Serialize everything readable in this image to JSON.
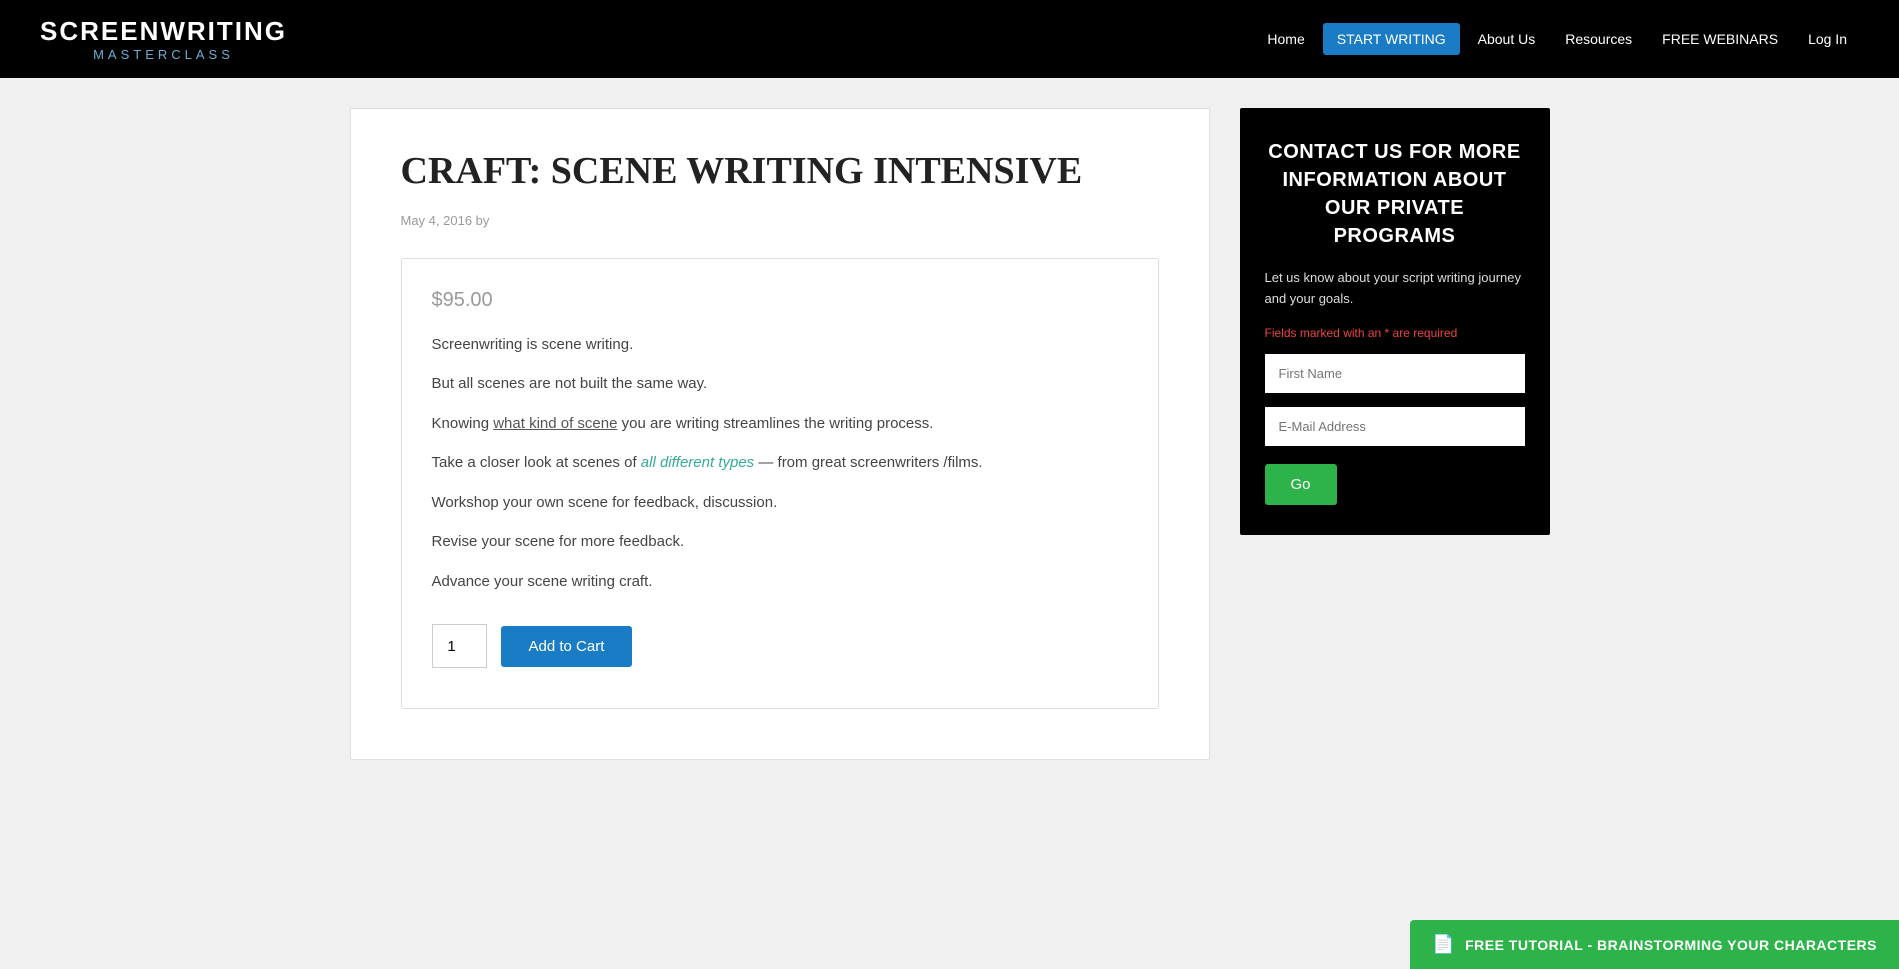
{
  "header": {
    "logo_main": "SCREENWRITING",
    "logo_sub": "MASTERCLASS",
    "nav": [
      {
        "label": "Home",
        "active": false
      },
      {
        "label": "START WRITING",
        "active": true
      },
      {
        "label": "About Us",
        "active": false
      },
      {
        "label": "Resources",
        "active": false
      },
      {
        "label": "FREE WEBINARS",
        "active": false
      },
      {
        "label": "Log In",
        "active": false
      }
    ]
  },
  "article": {
    "title": "CRAFT: SCENE WRITING INTENSIVE",
    "meta": "May 4, 2016 by",
    "product": {
      "price": "$95.00",
      "desc1": "Screenwriting is scene writing.",
      "desc2": "But all scenes are not built the same way.",
      "desc3_before": "Knowing ",
      "desc3_link": "what kind of scene",
      "desc3_after": " you are writing streamlines the writing process.",
      "desc4_before": "Take a closer look at scenes of ",
      "desc4_highlight": "all different types",
      "desc4_after": " — from great screenwriters /films.",
      "desc5": "Workshop your own scene for feedback, discussion.",
      "desc6": "Revise your scene for more feedback.",
      "desc7": "Advance your scene writing craft.",
      "qty_value": "1",
      "add_to_cart": "Add to Cart"
    }
  },
  "sidebar": {
    "contact_title": "CONTACT US FOR MORE INFORMATION ABOUT OUR PRIVATE PROGRAMS",
    "contact_desc": "Let us know about your script writing journey and your goals.",
    "fields_required": "Fields marked with an ",
    "fields_required_star": "*",
    "fields_required_suffix": " are required",
    "first_name_placeholder": "First Name",
    "email_placeholder": "E-Mail Address",
    "go_label": "Go"
  },
  "footer_bar": {
    "icon": "📄",
    "label": "FREE TUTORIAL - BRAINSTORMING YOUR CHARACTERS"
  }
}
